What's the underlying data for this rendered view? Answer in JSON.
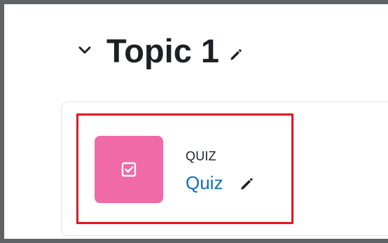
{
  "section": {
    "title": "Topic 1",
    "collapse_icon": "chevron-down-icon",
    "edit_icon": "pencil-icon"
  },
  "activity": {
    "type_label": "QUIZ",
    "name": "Quiz",
    "icon": "quiz-checkbox-icon",
    "edit_icon": "pencil-icon",
    "icon_color": "#ef6aa6",
    "link_color": "#0f6cbf"
  },
  "annotation": {
    "highlight_color": "#e8141f"
  }
}
